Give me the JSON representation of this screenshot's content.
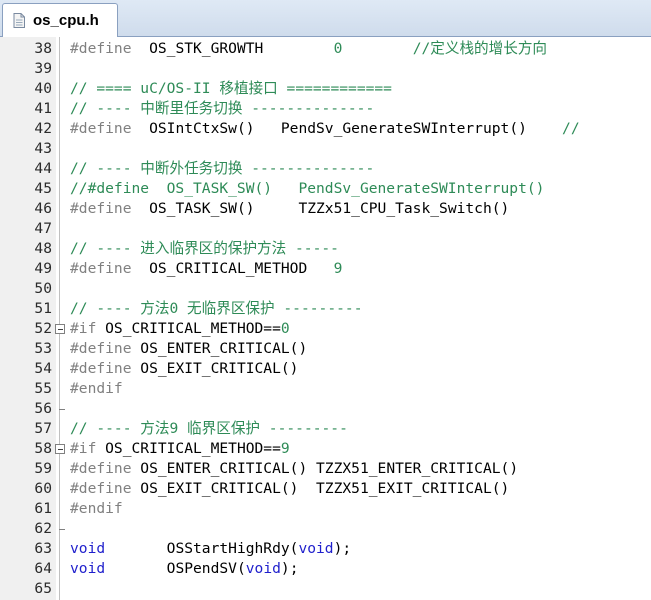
{
  "tab": {
    "title": "os_cpu.h"
  },
  "lines": [
    {
      "n": "38",
      "parts": [
        [
          "pre",
          "#define"
        ],
        [
          "id",
          "  OS_STK_GROWTH        "
        ],
        [
          "num",
          "0"
        ],
        [
          "id",
          "        "
        ],
        [
          "cm",
          "//定义栈的增长方向"
        ]
      ]
    },
    {
      "n": "39",
      "parts": []
    },
    {
      "n": "40",
      "parts": [
        [
          "cm",
          "// ==== uC/OS-II 移植接口 ============"
        ]
      ]
    },
    {
      "n": "41",
      "parts": [
        [
          "cm",
          "// ---- 中断里任务切换 --------------"
        ]
      ]
    },
    {
      "n": "42",
      "parts": [
        [
          "pre",
          "#define"
        ],
        [
          "id",
          "  OSIntCtxSw()   PendSv_GenerateSWInterrupt()    "
        ],
        [
          "cm",
          "//"
        ]
      ]
    },
    {
      "n": "43",
      "parts": []
    },
    {
      "n": "44",
      "parts": [
        [
          "cm",
          "// ---- 中断外任务切换 --------------"
        ]
      ]
    },
    {
      "n": "45",
      "parts": [
        [
          "cm",
          "//#define  OS_TASK_SW()   PendSv_GenerateSWInterrupt()    "
        ]
      ]
    },
    {
      "n": "46",
      "parts": [
        [
          "pre",
          "#define"
        ],
        [
          "id",
          "  OS_TASK_SW()     TZZx51_CPU_Task_Switch()"
        ]
      ]
    },
    {
      "n": "47",
      "parts": []
    },
    {
      "n": "48",
      "parts": [
        [
          "cm",
          "// ---- 进入临界区的保护方法 -----"
        ]
      ]
    },
    {
      "n": "49",
      "parts": [
        [
          "pre",
          "#define"
        ],
        [
          "id",
          "  OS_CRITICAL_METHOD   "
        ],
        [
          "num",
          "9"
        ]
      ]
    },
    {
      "n": "50",
      "parts": []
    },
    {
      "n": "51",
      "parts": [
        [
          "cm",
          "// ---- 方法0 无临界区保护 ---------"
        ]
      ]
    },
    {
      "n": "52",
      "fold": "open",
      "parts": [
        [
          "pre",
          "#if"
        ],
        [
          "id",
          " OS_CRITICAL_METHOD=="
        ],
        [
          "num",
          "0"
        ]
      ]
    },
    {
      "n": "53",
      "parts": [
        [
          "pre",
          "#define"
        ],
        [
          "id",
          " OS_ENTER_CRITICAL()"
        ]
      ]
    },
    {
      "n": "54",
      "parts": [
        [
          "pre",
          "#define"
        ],
        [
          "id",
          " OS_EXIT_CRITICAL()"
        ]
      ]
    },
    {
      "n": "55",
      "parts": [
        [
          "pre",
          "#endif"
        ]
      ]
    },
    {
      "n": "56",
      "fold": "end",
      "parts": []
    },
    {
      "n": "57",
      "parts": [
        [
          "cm",
          "// ---- 方法9 临界区保护 ---------"
        ]
      ]
    },
    {
      "n": "58",
      "fold": "open",
      "parts": [
        [
          "pre",
          "#if"
        ],
        [
          "id",
          " OS_CRITICAL_METHOD=="
        ],
        [
          "num",
          "9"
        ]
      ]
    },
    {
      "n": "59",
      "parts": [
        [
          "pre",
          "#define"
        ],
        [
          "id",
          " OS_ENTER_CRITICAL() TZZX51_ENTER_CRITICAL()"
        ]
      ]
    },
    {
      "n": "60",
      "parts": [
        [
          "pre",
          "#define"
        ],
        [
          "id",
          " OS_EXIT_CRITICAL()  TZZX51_EXIT_CRITICAL()"
        ]
      ]
    },
    {
      "n": "61",
      "parts": [
        [
          "pre",
          "#endif"
        ]
      ]
    },
    {
      "n": "62",
      "fold": "end",
      "parts": []
    },
    {
      "n": "63",
      "parts": [
        [
          "kw",
          "void"
        ],
        [
          "id",
          "       OSStartHighRdy("
        ],
        [
          "kw",
          "void"
        ],
        [
          "id",
          ");"
        ]
      ]
    },
    {
      "n": "64",
      "parts": [
        [
          "kw",
          "void"
        ],
        [
          "id",
          "       OSPendSV("
        ],
        [
          "kw",
          "void"
        ],
        [
          "id",
          ");"
        ]
      ]
    },
    {
      "n": "65",
      "parts": []
    }
  ],
  "colors": {
    "comment": "#2e8b57",
    "keyword": "#1f1fcc",
    "preprocessor": "#808080",
    "number": "#2e8b57"
  }
}
